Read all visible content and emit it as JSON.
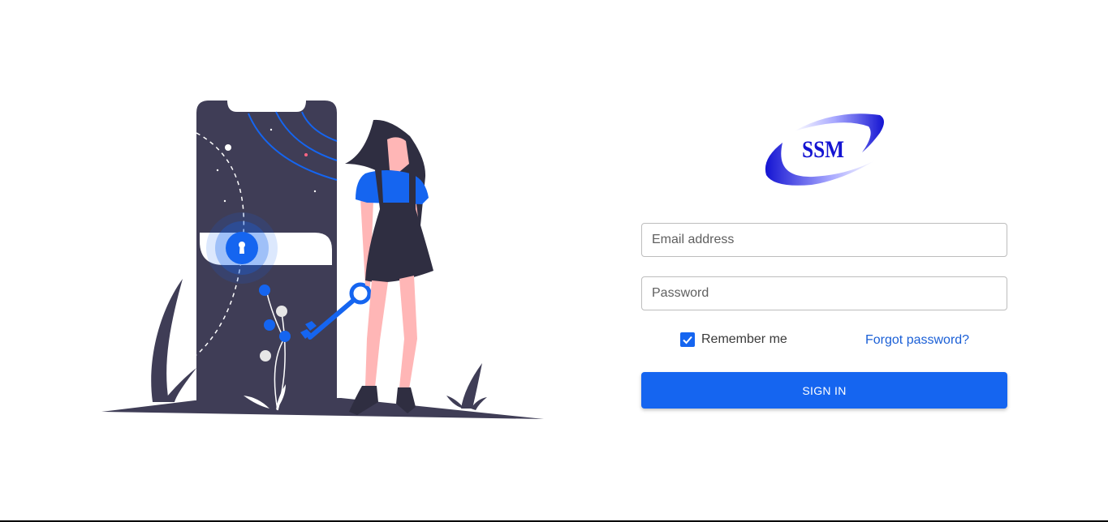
{
  "logo": {
    "text": "SSM"
  },
  "login": {
    "email_placeholder": "Email address",
    "password_placeholder": "Password",
    "remember_label": "Remember me",
    "remember_checked": true,
    "forgot_label": "Forgot password?",
    "signin_label": "SIGN IN"
  },
  "colors": {
    "primary": "#1565f0",
    "link": "#1a5fd6",
    "illustration_dark": "#3f3d56",
    "skin": "#ffb6b6",
    "logo_blue": "#1414d2"
  },
  "icons": {
    "checkbox": "check-icon",
    "lock": "keyhole-icon"
  }
}
